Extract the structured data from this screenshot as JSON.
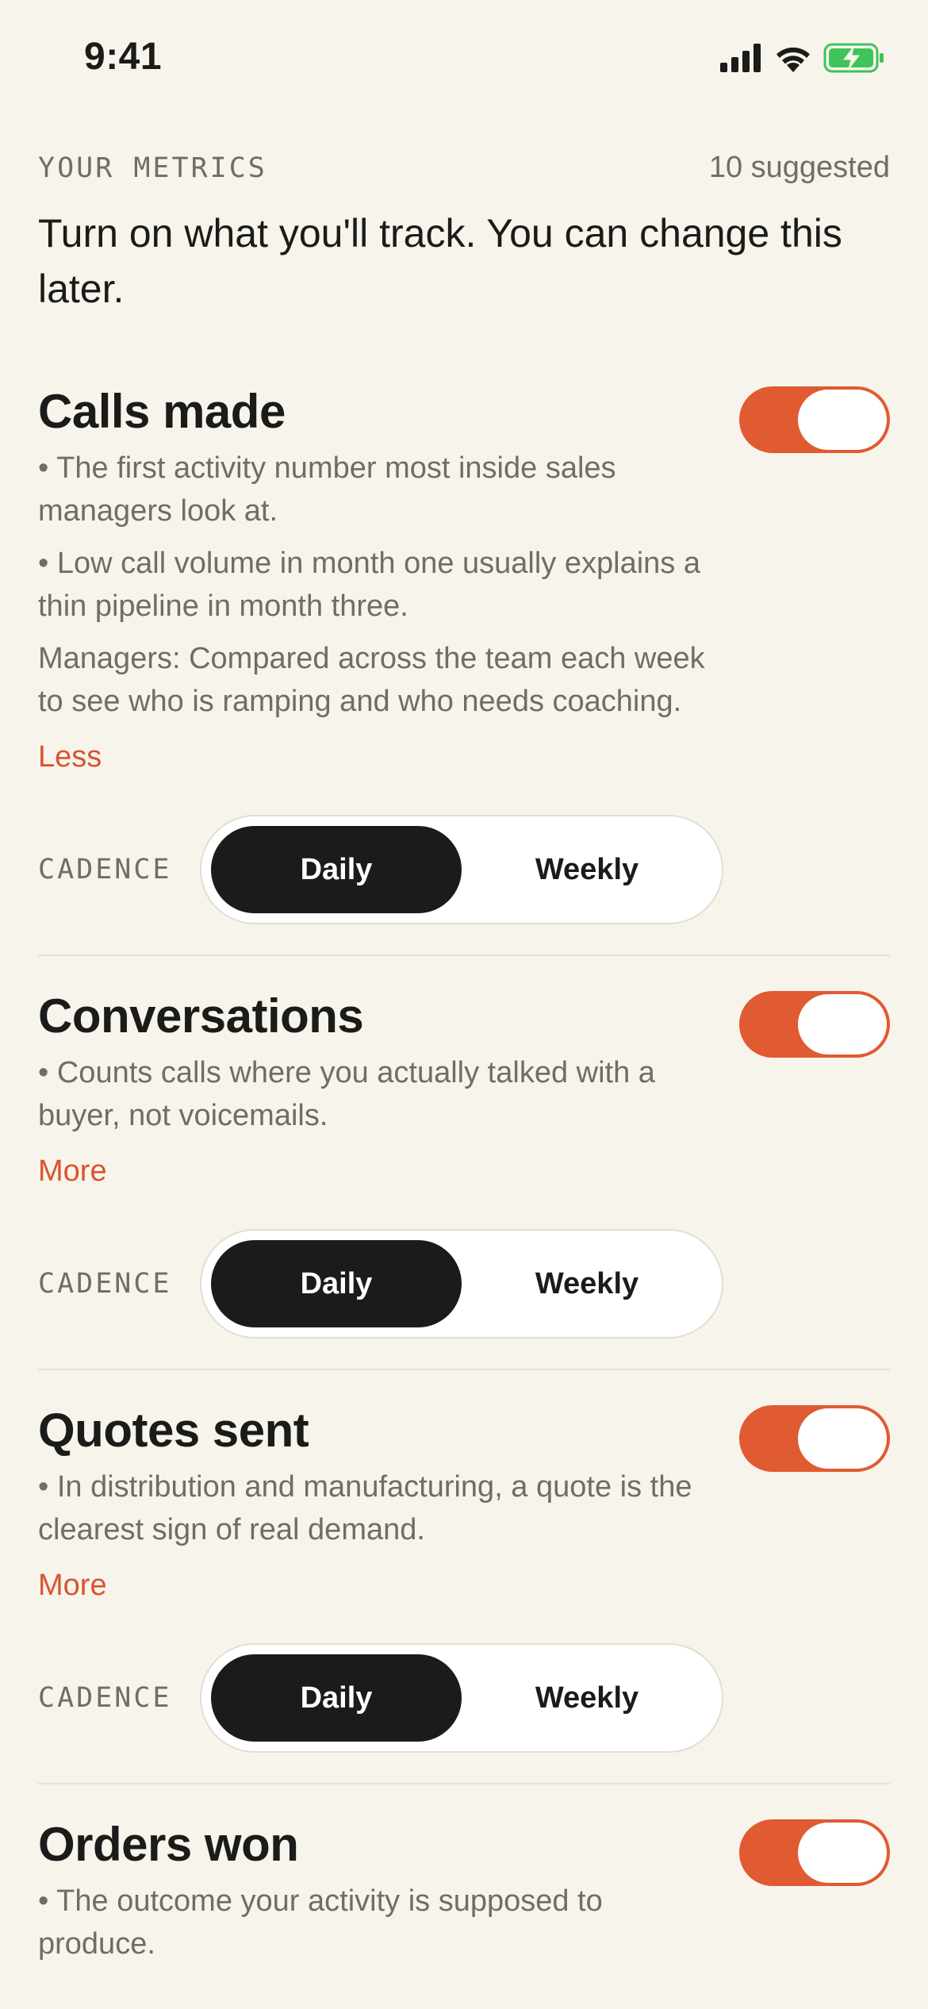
{
  "status": {
    "time": "9:41"
  },
  "header": {
    "section_label": "YOUR METRICS",
    "suggested": "10 suggested",
    "intro": "Turn on what you'll track. You can change this later."
  },
  "cadence_label": "CADENCE",
  "colors": {
    "accent": "#e05a32",
    "background": "#f7f4ec",
    "dark": "#1b1b19"
  },
  "metrics": [
    {
      "title": "Calls made",
      "enabled": true,
      "bullets": [
        "• The first activity number most inside sales managers look at.",
        "• Low call volume in month one usually explains a thin pipeline in month three.",
        "Managers: Compared across the team each week to see who is ramping and who needs coaching."
      ],
      "toggle_link": "Less",
      "cadence_options": [
        "Daily",
        "Weekly"
      ],
      "cadence_selected": "Daily"
    },
    {
      "title": "Conversations",
      "enabled": true,
      "bullets": [
        "• Counts calls where you actually talked with a buyer, not voicemails."
      ],
      "toggle_link": "More",
      "cadence_options": [
        "Daily",
        "Weekly"
      ],
      "cadence_selected": "Daily"
    },
    {
      "title": "Quotes sent",
      "enabled": true,
      "bullets": [
        "• In distribution and manufacturing, a quote is the clearest sign of real demand."
      ],
      "toggle_link": "More",
      "cadence_options": [
        "Daily",
        "Weekly"
      ],
      "cadence_selected": "Daily"
    },
    {
      "title": "Orders won",
      "enabled": true,
      "bullets": [
        "• The outcome your activity is supposed to produce."
      ]
    }
  ]
}
